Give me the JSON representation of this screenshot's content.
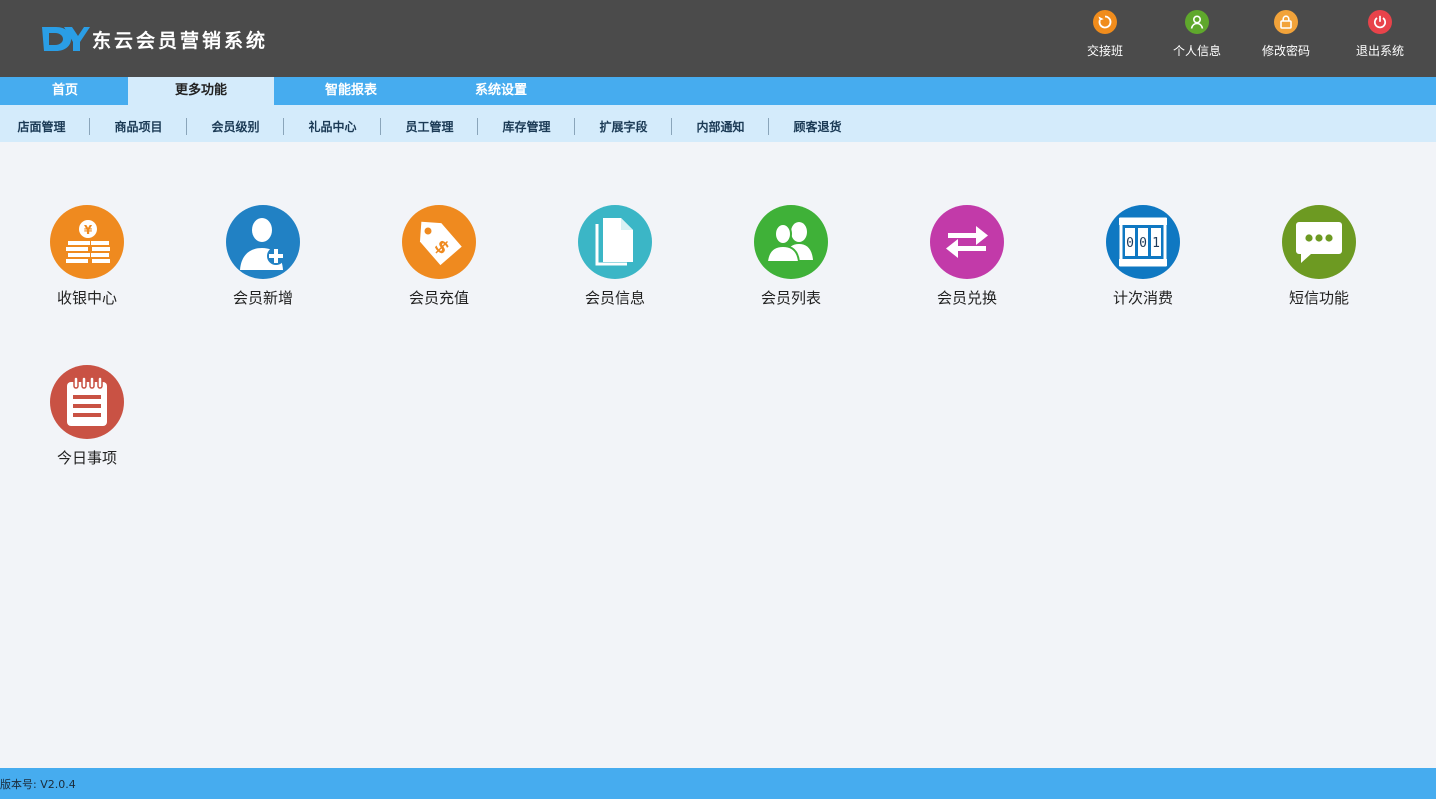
{
  "app": {
    "logo_text": "DY",
    "title": "东云会员营销系统"
  },
  "top_actions": [
    {
      "label": "交接班",
      "icon": "refresh-icon",
      "color": "#f08c1c"
    },
    {
      "label": "个人信息",
      "icon": "user-icon",
      "color": "#5fa82c"
    },
    {
      "label": "修改密码",
      "icon": "lock-icon",
      "color": "#f2a33a"
    },
    {
      "label": "退出系统",
      "icon": "power-icon",
      "color": "#e8434a"
    }
  ],
  "main_tabs": [
    {
      "label": "首页",
      "active": false
    },
    {
      "label": "更多功能",
      "active": true
    },
    {
      "label": "智能报表",
      "active": false
    },
    {
      "label": "系统设置",
      "active": false
    }
  ],
  "sub_tabs": [
    "店面管理",
    "商品项目",
    "会员级别",
    "礼品中心",
    "员工管理",
    "库存管理",
    "扩展字段",
    "内部通知",
    "顾客退货"
  ],
  "tiles": [
    {
      "label": "收银中心",
      "icon": "cash-icon",
      "color": "#ef8a1f"
    },
    {
      "label": "会员新增",
      "icon": "add-user-icon",
      "color": "#2181c4"
    },
    {
      "label": "会员充值",
      "icon": "price-tag-icon",
      "color": "#ef8a1f"
    },
    {
      "label": "会员信息",
      "icon": "document-icon",
      "color": "#3bb6c6"
    },
    {
      "label": "会员列表",
      "icon": "users-icon",
      "color": "#3fb138"
    },
    {
      "label": "会员兑换",
      "icon": "exchange-icon",
      "color": "#c23aa9"
    },
    {
      "label": "计次消费",
      "icon": "counter-icon",
      "color": "#0f78c2"
    },
    {
      "label": "短信功能",
      "icon": "message-icon",
      "color": "#6d9a22"
    },
    {
      "label": "今日事项",
      "icon": "notepad-icon",
      "color": "#c95244"
    }
  ],
  "counter_digits": "001",
  "footer": {
    "version": "版本号: V2.0.4"
  }
}
